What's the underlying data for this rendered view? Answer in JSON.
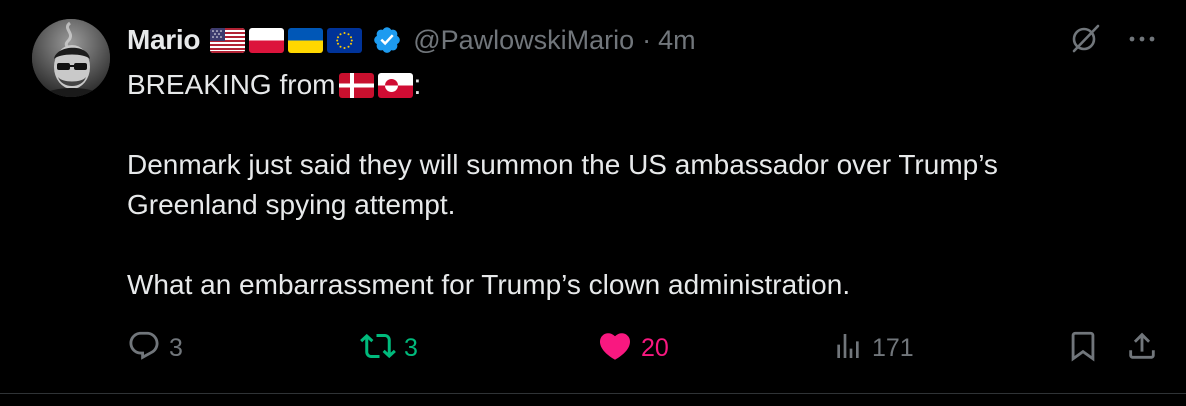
{
  "tweet": {
    "author_name": "Mario",
    "handle": "@PawlowskiMario",
    "separator": "·",
    "time_ago": "4m",
    "name_flags": [
      "us-flag",
      "poland-flag",
      "ukraine-flag",
      "eu-flag"
    ],
    "verified_icon": "verified-badge-icon",
    "line1_prefix": "BREAKING from",
    "line1_flags": [
      "denmark-flag",
      "greenland-flag"
    ],
    "line1_suffix": ":",
    "paragraph2": [
      "Denmark just said they will summon the US ambassador over Trump’s",
      "Greenland spying attempt."
    ],
    "paragraph3": "What an embarrassment for Trump’s clown administration."
  },
  "actions": {
    "reply_count": "3",
    "retweet_count": "3",
    "like_count": "20",
    "views_count": "171"
  },
  "icons": {
    "reply": "reply-icon",
    "retweet": "retweet-icon",
    "like": "heart-icon",
    "views": "views-icon",
    "bookmark": "bookmark-icon",
    "share": "share-icon",
    "grok": "grok-icon",
    "more": "more-icon"
  },
  "colors": {
    "background": "#000000",
    "text_primary": "#e7e9ea",
    "text_secondary": "#71767b",
    "verified_blue": "#1d9bf0",
    "retweet_green": "#00ba7c",
    "like_pink": "#f91880",
    "divider": "#2f3336"
  }
}
